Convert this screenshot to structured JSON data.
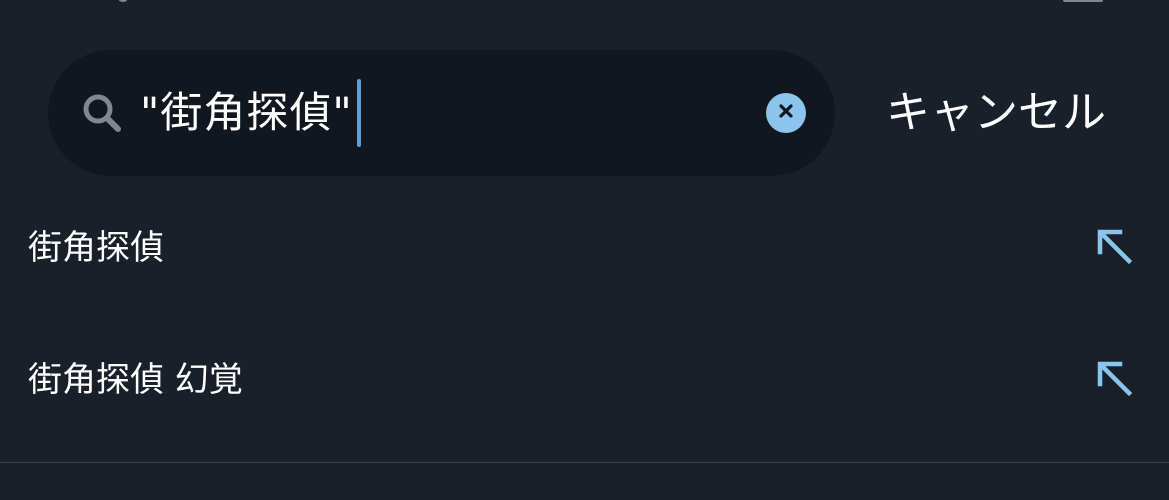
{
  "search": {
    "value": "\"街角探偵\"",
    "clear_icon": "clear-circle-icon",
    "search_icon": "search-icon"
  },
  "cancel_label": "キャンセル",
  "suggestions": [
    {
      "label": "街角探偵",
      "icon": "arrow-up-left-icon"
    },
    {
      "label": "街角探偵 幻覚",
      "icon": "arrow-up-left-icon"
    }
  ],
  "colors": {
    "background": "#1a202a",
    "search_field": "#12161e",
    "accent": "#8bc5ee",
    "caret": "#5aa0e0",
    "text": "#ffffff",
    "icon_muted": "#7e8792"
  }
}
